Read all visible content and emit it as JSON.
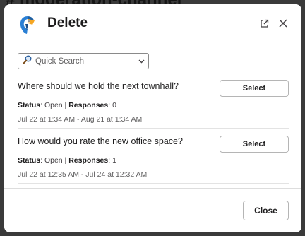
{
  "background": {
    "channel_title": "# moderation-channel"
  },
  "modal": {
    "title": "Delete",
    "app_icon": "parrot-icon",
    "external_icon": "external-link-icon",
    "close_icon": "close-icon"
  },
  "search": {
    "placeholder": "Quick Search",
    "icon": "magnifier-icon",
    "dropdown_icon": "chevron-down-icon"
  },
  "polls": [
    {
      "question": "Where should we hold the next townhall?",
      "select_label": "Select",
      "status_label": "Status",
      "status_value": "Open",
      "separator": "|",
      "responses_label": "Responses",
      "responses_value": "0",
      "dates": "Jul 22 at 1:34 AM - Aug 21 at 1:34 AM"
    },
    {
      "question": "How would you rate the new office space?",
      "select_label": "Select",
      "status_label": "Status",
      "status_value": "Open",
      "separator": "|",
      "responses_label": "Responses",
      "responses_value": "1",
      "dates": "Jul 22 at 12:35 AM - Jul 24 at 12:32 AM"
    }
  ],
  "footer": {
    "close_label": "Close"
  },
  "colors": {
    "overlay": "#3a3a3a",
    "text": "#1d1c1d",
    "parrot_blue": "#2a7fd4",
    "parrot_orange": "#f5a623"
  }
}
